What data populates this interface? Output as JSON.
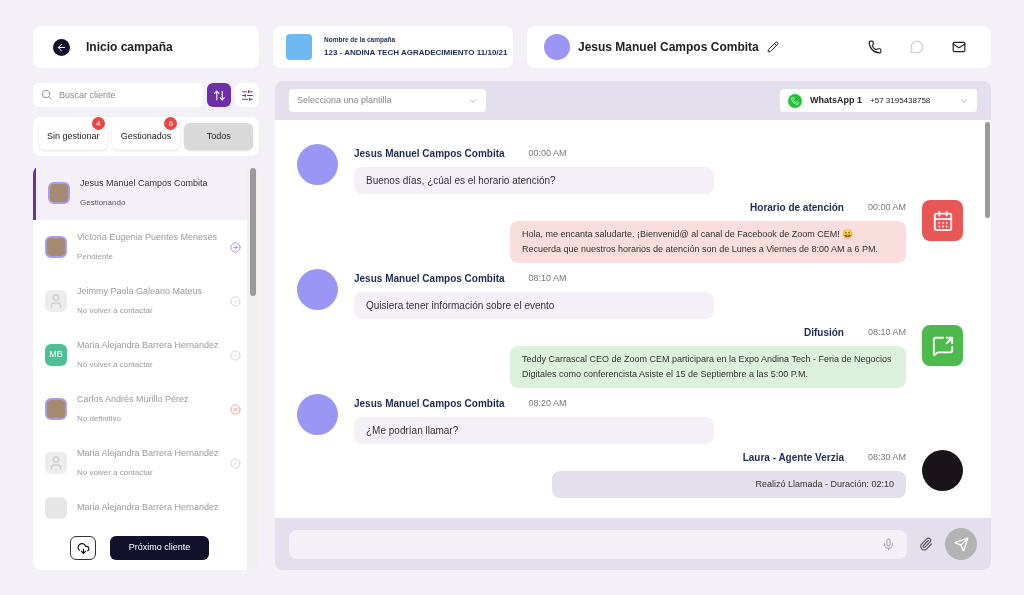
{
  "back": {
    "label": "Inicio campaña"
  },
  "campaign": {
    "caption": "Nombre de la campaña",
    "name": "123 - ANDINA TECH AGRADECIMIENTO 11/10/21"
  },
  "contact": {
    "name": "Jesus Manuel Campos Combita"
  },
  "search": {
    "placeholder": "Buscar cliente"
  },
  "filters": [
    {
      "label": "Sin gestionar",
      "count": "4",
      "selected": false
    },
    {
      "label": "Gestionados",
      "count": "6",
      "selected": false
    },
    {
      "label": "Todos",
      "selected": true
    }
  ],
  "clients": [
    {
      "name": "Jesus Manuel Campos Combita",
      "status": "Gestionando",
      "selected": true,
      "avatar": {
        "kind": "photo"
      }
    },
    {
      "name": "Victoria Eugenia Puentes Meneses",
      "status": "Pendiente",
      "selected": false,
      "avatar": {
        "kind": "photo"
      },
      "status_icon": {
        "kind": "arrow"
      }
    },
    {
      "name": "Jeimmy Paola Galeano Mateus",
      "status": "No volver a contactar",
      "selected": false,
      "avatar": {
        "kind": "silhouette"
      },
      "status_icon": {
        "kind": "check"
      }
    },
    {
      "name": "Maria Alejandra Barrera Hernandez",
      "status": "No volver a contactar",
      "selected": false,
      "avatar": {
        "kind": "initials",
        "initials": "MB"
      },
      "status_icon": {
        "kind": "check"
      }
    },
    {
      "name": "Carlos Andrés Murillo Pérez",
      "status": "No definitivo",
      "selected": false,
      "avatar": {
        "kind": "photo"
      },
      "status_icon": {
        "kind": "cross"
      }
    },
    {
      "name": "Maria Alejandra Barrera Hernandez",
      "status": "No volver a contactar",
      "selected": false,
      "avatar": {
        "kind": "silhouette"
      },
      "status_icon": {
        "kind": "check"
      }
    },
    {
      "name": "Maria Alejandra Barrera Hernandez",
      "selected": false,
      "avatar": {
        "kind": "blank"
      }
    }
  ],
  "next_button": {
    "label": "Próximo cliente"
  },
  "template_select": {
    "placeholder": "Selecciona una plantilla"
  },
  "channel_select": {
    "name": "WhatsApp 1",
    "number": "+57 3195438758"
  },
  "messages": [
    {
      "kind": "client",
      "author": "Jesus Manuel Campos Combita",
      "time": "00:00 AM",
      "text": "Buenos días, ¿cúal es el horario atención?"
    },
    {
      "kind": "template",
      "icon": {
        "kind": "calendar"
      },
      "color": "#e85656",
      "author": "Horario de atención",
      "time": "00:00 AM",
      "text": "Hola, me encanta saludarte. ¡Bienvenid@ al canal de Facebook de Zoom CEM! 😀 Recuerda que nuestros horarios de atención son de Lunes a Viernes de 8:00 AM  a 6 PM."
    },
    {
      "kind": "client",
      "author": "Jesus Manuel Campos Combita",
      "time": "08:10 AM",
      "text": "Quisiera tener información sobre el evento"
    },
    {
      "kind": "template",
      "icon": {
        "kind": "broadcast"
      },
      "color": "#4cbb4c",
      "author": "Difusión",
      "time": "08:10 AM",
      "text": "Teddy Carrascal CEO de Zoom CEM participara en la Expo Andina Tech - Feria de Negocios Digitales como conferencista Asiste el 15 de Septiembre a las 5:00 P.M."
    },
    {
      "kind": "client",
      "author": "Jesus Manuel Campos Combita",
      "time": "08:20 AM",
      "text": "¿Me podrían llamar?"
    },
    {
      "kind": "agent",
      "author": "Laura - Agente Verzia",
      "time": "08:30 AM",
      "text": "Realizó Llamada - Duración: 02:10"
    }
  ]
}
